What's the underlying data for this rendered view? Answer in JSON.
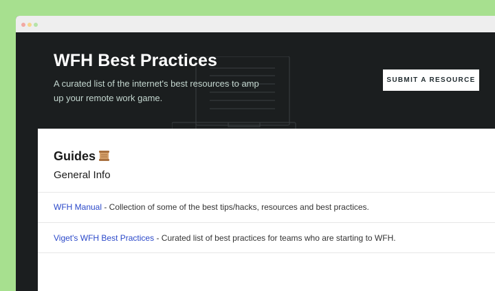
{
  "hero": {
    "title": "WFH Best Practices",
    "description": "A curated list of the internet's best resources to amp up your remote work game.",
    "submit_label": "SUBMIT A RESOURCE"
  },
  "guides": {
    "title": "Guides",
    "icon": "scroll-icon",
    "subtitle": "General Info",
    "items": [
      {
        "link": "WFH Manual",
        "description": " - Collection of some of the best tips/hacks, resources and best practices."
      },
      {
        "link": "Viget's WFH Best Practices",
        "description": " - Curated list of best practices for teams who are starting to WFH."
      }
    ]
  },
  "colors": {
    "background": "#a7e08f",
    "hero_bg": "#1b1e1f",
    "link": "#2a48c9"
  }
}
